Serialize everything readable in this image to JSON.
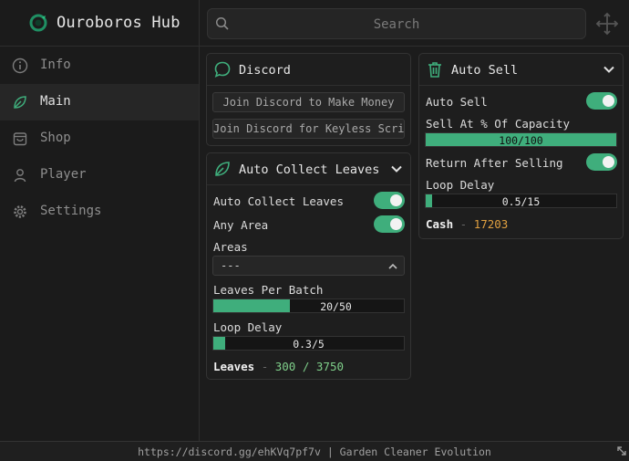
{
  "app": {
    "title": "Ouroboros Hub"
  },
  "sidebar": {
    "items": [
      {
        "label": "Info",
        "icon": "info-icon",
        "active": false
      },
      {
        "label": "Main",
        "icon": "leaf-icon",
        "active": true
      },
      {
        "label": "Shop",
        "icon": "shopping-bag-icon",
        "active": false
      },
      {
        "label": "Player",
        "icon": "user-icon",
        "active": false
      },
      {
        "label": "Settings",
        "icon": "gear-icon",
        "active": false
      }
    ]
  },
  "search": {
    "placeholder": "Search"
  },
  "discord": {
    "title": "Discord",
    "buttons": [
      "Join Discord to Make Money",
      "Join Discord for Keyless Scripts"
    ]
  },
  "auto_collect": {
    "title": "Auto Collect Leaves",
    "toggles": [
      {
        "label": "Auto Collect Leaves",
        "on": true
      },
      {
        "label": "Any Area",
        "on": true
      }
    ],
    "areas_label": "Areas",
    "areas_value": "---",
    "leaves_per_batch": {
      "label": "Leaves Per Batch",
      "text": "20/50",
      "fraction": 0.4
    },
    "loop_delay": {
      "label": "Loop Delay",
      "text": "0.3/5",
      "fraction": 0.06
    },
    "stat": {
      "key": "Leaves",
      "sep": "-",
      "value": "300 / 3750"
    }
  },
  "auto_sell": {
    "title": "Auto Sell",
    "toggle": {
      "label": "Auto Sell",
      "on": true
    },
    "capacity": {
      "label": "Sell At % Of Capacity",
      "text": "100/100",
      "fraction": 1.0
    },
    "return_toggle": {
      "label": "Return After Selling",
      "on": true
    },
    "loop_delay": {
      "label": "Loop Delay",
      "text": "0.5/15",
      "fraction": 0.033
    },
    "stat": {
      "key": "Cash",
      "sep": "-",
      "value": "17203"
    }
  },
  "footer": {
    "text": "https://discord.gg/ehKVq7pf7v | Garden Cleaner Evolution"
  },
  "colors": {
    "accent": "#3fae7c",
    "leaves_value": "#7fcf8a",
    "cash_value": "#e0a040"
  }
}
